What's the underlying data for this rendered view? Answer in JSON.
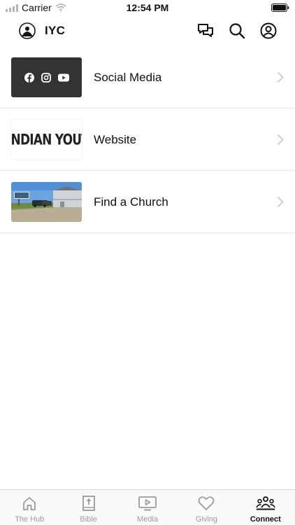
{
  "status_bar": {
    "carrier": "Carrier",
    "time": "12:54 PM"
  },
  "header": {
    "brand": "IYC"
  },
  "list": [
    {
      "label": "Social Media"
    },
    {
      "label": "Website",
      "thumb_text": "INDIAN YOUTH"
    },
    {
      "label": "Find a Church"
    }
  ],
  "tabs": [
    {
      "label": "The Hub",
      "icon": "home-icon",
      "active": false
    },
    {
      "label": "Bible",
      "icon": "bible-icon",
      "active": false
    },
    {
      "label": "Media",
      "icon": "media-icon",
      "active": false
    },
    {
      "label": "Giving",
      "icon": "heart-icon",
      "active": false
    },
    {
      "label": "Connect",
      "icon": "people-icon",
      "active": true
    }
  ],
  "colors": {
    "active_tab": "#111111",
    "inactive_tab": "#9a9a9a",
    "divider": "#e3e3e3",
    "social_thumb": "#333333"
  }
}
